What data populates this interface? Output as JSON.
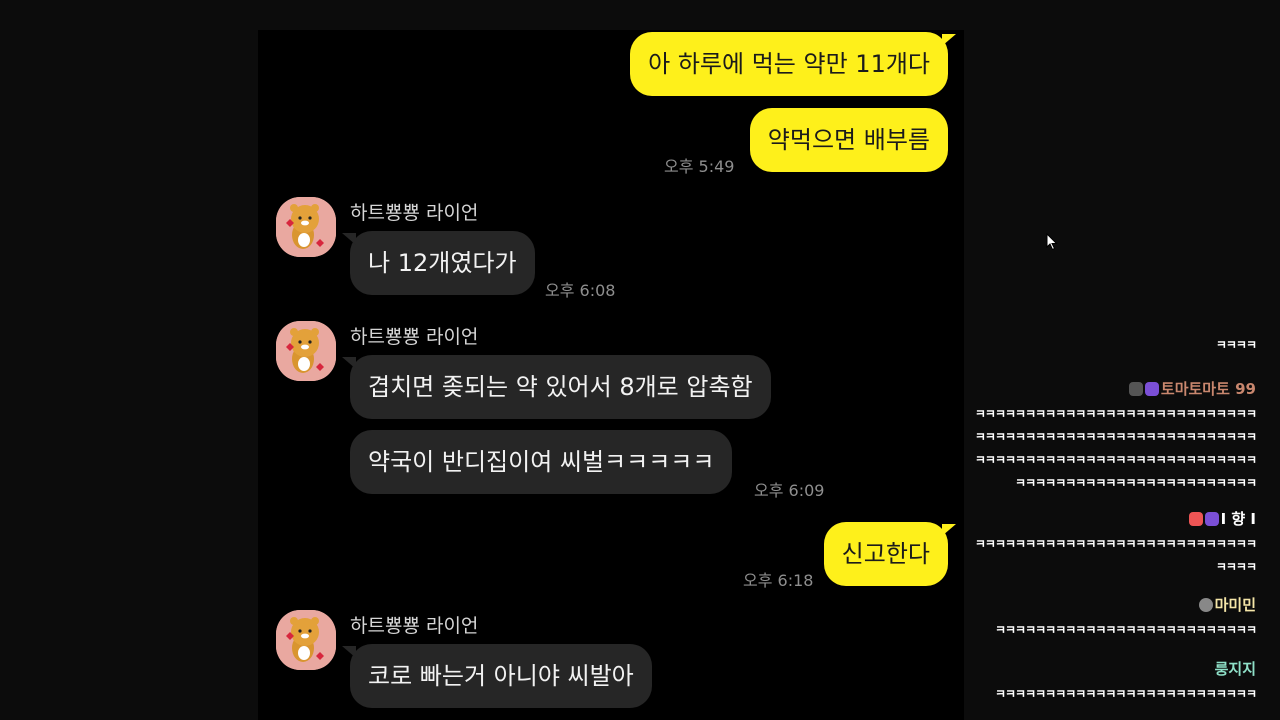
{
  "chat": {
    "messages": [
      {
        "from": "me",
        "text": "아 하루에 먹는 약만 11개다"
      },
      {
        "from": "me",
        "text": "약먹으면 배부름",
        "time": "오후 5:49"
      },
      {
        "from": "other",
        "sender": "하트뿅뿅 라이언",
        "text": "나 12개였다가",
        "time": "오후 6:08"
      },
      {
        "from": "other",
        "sender": "하트뿅뿅 라이언",
        "text": "겹치면 좆되는 약 있어서 8개로 압축함"
      },
      {
        "from": "other",
        "text": "약국이 반디집이여 씨벌ㅋㅋㅋㅋㅋ",
        "time": "오후 6:09"
      },
      {
        "from": "me",
        "text": "신고한다",
        "time": "오후 6:18"
      },
      {
        "from": "other",
        "sender": "하트뿅뿅 라이언",
        "text": "코로 빠는거 아니야 씨발아"
      }
    ],
    "avatar_icon": "ryan-character-avatar"
  },
  "live_chat": {
    "entries": [
      {
        "name": "",
        "lines": [
          "ㅋㅋㅋㅋ"
        ]
      },
      {
        "name": "토마토마토 99",
        "name_color": "#c9876e",
        "lines": [
          "ㅋㅋㅋㅋㅋㅋㅋㅋㅋㅋㅋㅋㅋㅋㅋㅋㅋㅋㅋㅋㅋㅋㅋㅋㅋㅋㅋㅋ",
          "ㅋㅋㅋㅋㅋㅋㅋㅋㅋㅋㅋㅋㅋㅋㅋㅋㅋㅋㅋㅋㅋㅋㅋㅋㅋㅋㅋㅋ",
          "ㅋㅋㅋㅋㅋㅋㅋㅋㅋㅋㅋㅋㅋㅋㅋㅋㅋㅋㅋㅋㅋㅋㅋㅋㅋㅋㅋㅋ",
          "ㅋㅋㅋㅋㅋㅋㅋㅋㅋㅋㅋㅋㅋㅋㅋㅋㅋㅋㅋㅋㅋㅋㅋㅋ"
        ]
      },
      {
        "name": "I 향 I",
        "name_color": "#ffffff",
        "lines": [
          "ㅋㅋㅋㅋㅋㅋㅋㅋㅋㅋㅋㅋㅋㅋㅋㅋㅋㅋㅋㅋㅋㅋㅋㅋㅋㅋㅋㅋ",
          "ㅋㅋㅋㅋ"
        ]
      },
      {
        "name": "마미민",
        "name_color": "#f5e6a8",
        "lines": [
          "ㅋㅋㅋㅋㅋㅋㅋㅋㅋㅋㅋㅋㅋㅋㅋㅋㅋㅋㅋㅋㅋㅋㅋㅋㅋㅋ"
        ]
      },
      {
        "name": "룽지지",
        "name_color": "#8fe0c8",
        "lines": [
          "ㅋㅋㅋㅋㅋㅋㅋㅋㅋㅋㅋㅋㅋㅋㅋㅋㅋㅋㅋㅋㅋㅋㅋㅋㅋㅋ"
        ]
      }
    ]
  },
  "colors": {
    "my_bubble": "#fef01b",
    "other_bubble": "#262626",
    "background": "#000000"
  }
}
